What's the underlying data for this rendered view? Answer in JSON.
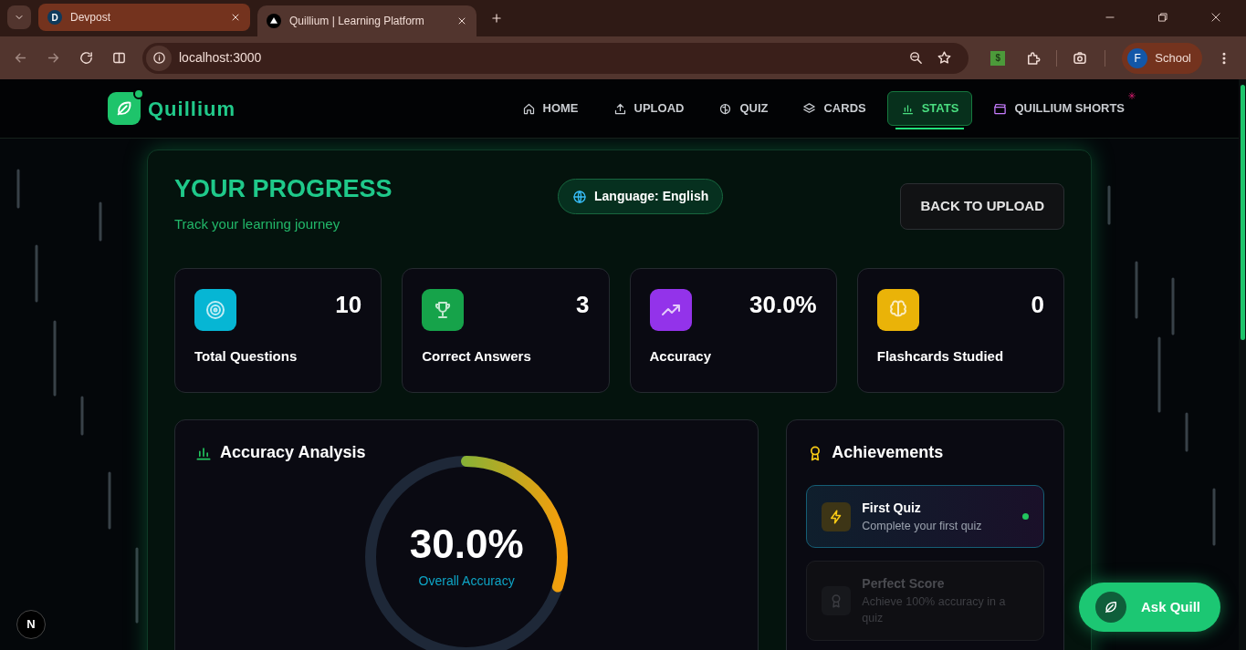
{
  "browser": {
    "tabs": [
      {
        "title": "Devpost",
        "favicon": "D",
        "selected": false
      },
      {
        "title": "Quillium | Learning Platform",
        "selected": true
      }
    ],
    "address": "localhost:3000",
    "extension_label": "$",
    "profile": {
      "initial": "F",
      "name": "School"
    }
  },
  "app": {
    "brand": "Quillium",
    "nav": [
      {
        "label": "HOME",
        "selected": false
      },
      {
        "label": "UPLOAD",
        "selected": false
      },
      {
        "label": "QUIZ",
        "selected": false
      },
      {
        "label": "CARDS",
        "selected": false
      },
      {
        "label": "STATS",
        "selected": true
      },
      {
        "label": "QUILLIUM SHORTS",
        "selected": false
      }
    ]
  },
  "progress": {
    "title": "YOUR PROGRESS",
    "subtitle": "Track your learning journey",
    "language": "Language: English",
    "back_button": "BACK TO UPLOAD"
  },
  "stats": [
    {
      "value": "10",
      "label": "Total Questions",
      "color": "#06b6d4"
    },
    {
      "value": "3",
      "label": "Correct Answers",
      "color": "#16a34a"
    },
    {
      "value": "30.0%",
      "label": "Accuracy",
      "color": "#9333ea"
    },
    {
      "value": "0",
      "label": "Flashcards Studied",
      "color": "#eab308"
    }
  ],
  "accuracy": {
    "title": "Accuracy Analysis",
    "value": "30.0%",
    "caption": "Overall Accuracy",
    "level": 0.3
  },
  "achievements": {
    "title": "Achievements",
    "items": [
      {
        "title": "First Quiz",
        "description": "Complete your first quiz",
        "unlocked": true
      },
      {
        "title": "Perfect Score",
        "description": "Achieve 100% accuracy in a quiz",
        "unlocked": false
      }
    ]
  },
  "assistant_button": "Ask Quill",
  "dev_badge": "N"
}
